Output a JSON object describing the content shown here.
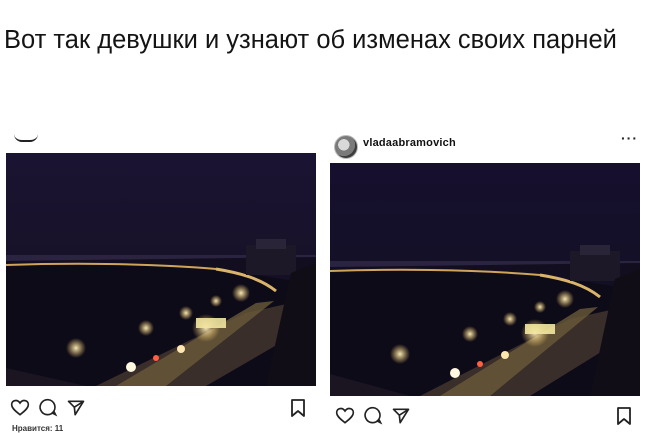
{
  "title": "Вот так девушки и узнают об изменах своих парней",
  "posts": [
    {
      "username": "",
      "likes": "Нравится: 11"
    },
    {
      "username": "vladaabramovich",
      "more": "···",
      "likes": ""
    }
  ],
  "icons": [
    "heart-icon",
    "comment-icon",
    "share-icon",
    "bookmark-icon",
    "more-icon"
  ],
  "colors": {
    "sky": "#150f2b",
    "water": "#0d0a18",
    "lights": "#ffd070"
  }
}
